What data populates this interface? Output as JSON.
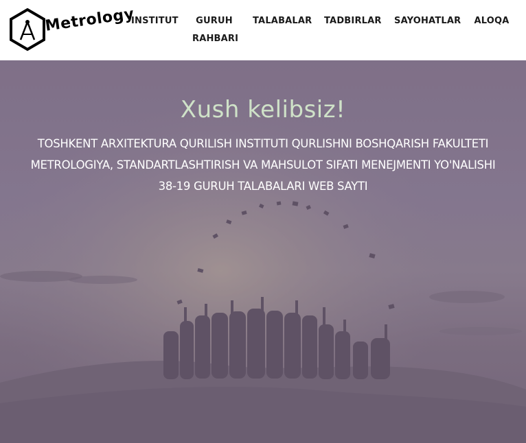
{
  "logo": {
    "icon": "compass-hexagon-icon",
    "text": "Metrology"
  },
  "nav": {
    "items": [
      {
        "label": "INSTITUT"
      },
      {
        "label": "GURUH"
      },
      {
        "label": "RAHBARI"
      },
      {
        "label": "TALABALAR"
      },
      {
        "label": "TADBIRLAR"
      },
      {
        "label": "SAYOHATLAR"
      },
      {
        "label": "ALOQA"
      }
    ]
  },
  "hero": {
    "title": "Xush kelibsiz!",
    "lines": [
      "TOSHKENT ARXITEKTURA QURILISH INSTITUTI QURLISHNI BOSHQARISH FAKULTETI",
      "METROLOGIYA, STANDARTLASHTIRISH VA MAHSULOT SIFATI MENEJMENTI YO'NALISHI",
      "38-19 GURUH TALABALARI WEB SAYTI"
    ],
    "background": "graduates-silhouette-image"
  },
  "colors": {
    "title": "#cfe2c8",
    "subtitle": "#ffffff",
    "overlay": "#7f7088"
  }
}
